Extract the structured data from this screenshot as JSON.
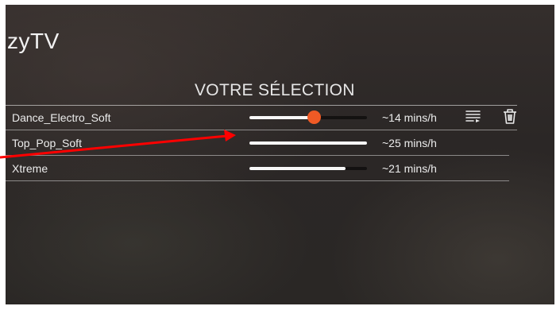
{
  "app": {
    "title": "zyTV"
  },
  "selection": {
    "title": "VOTRE SÉLECTION",
    "rows": [
      {
        "name": "Dance_Electro_Soft",
        "rate": "~14 mins/h",
        "level": 0.55,
        "has_thumb": true
      },
      {
        "name": "Top_Pop_Soft",
        "rate": "~25 mins/h",
        "level": 1.0,
        "has_thumb": false
      },
      {
        "name": "Xtreme",
        "rate": "~21 mins/h",
        "level": 0.82,
        "has_thumb": false
      }
    ]
  },
  "icons": {
    "reorder": "playlist-reorder-icon",
    "delete": "trash-icon"
  },
  "colors": {
    "accent": "#f05a25",
    "annotation_arrow": "#ff0000",
    "text": "#ececec"
  }
}
